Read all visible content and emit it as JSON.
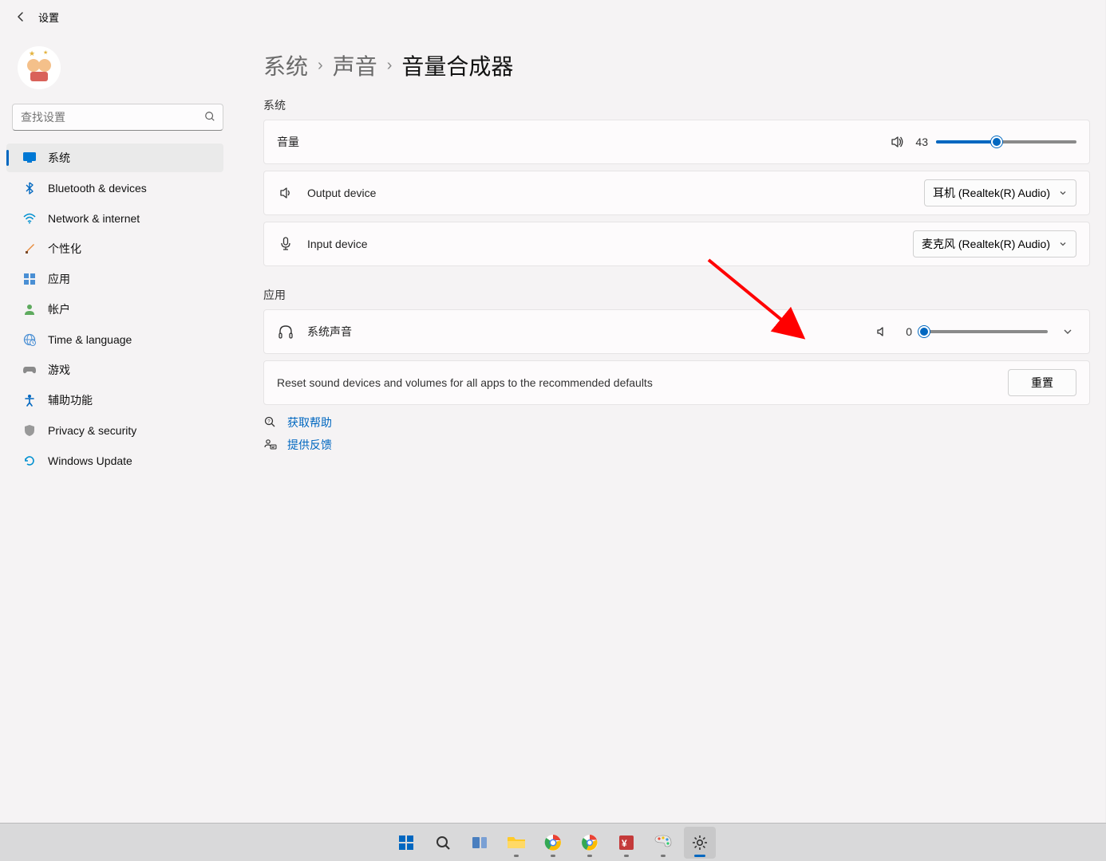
{
  "header": {
    "title": "设置"
  },
  "search": {
    "placeholder": "查找设置"
  },
  "nav": [
    {
      "key": "system",
      "label": "系统",
      "active": true
    },
    {
      "key": "bluetooth",
      "label": "Bluetooth & devices"
    },
    {
      "key": "network",
      "label": "Network & internet"
    },
    {
      "key": "personalization",
      "label": "个性化"
    },
    {
      "key": "apps",
      "label": "应用"
    },
    {
      "key": "accounts",
      "label": "帐户"
    },
    {
      "key": "time",
      "label": "Time & language"
    },
    {
      "key": "gaming",
      "label": "游戏"
    },
    {
      "key": "accessibility",
      "label": "辅助功能"
    },
    {
      "key": "privacy",
      "label": "Privacy & security"
    },
    {
      "key": "update",
      "label": "Windows Update"
    }
  ],
  "breadcrumb": {
    "system": "系统",
    "sound": "声音",
    "mixer": "音量合成器"
  },
  "sections": {
    "system": "系统",
    "apps": "应用"
  },
  "volume": {
    "label": "音量",
    "value": 43
  },
  "output": {
    "label": "Output device",
    "value": "耳机 (Realtek(R) Audio)"
  },
  "input": {
    "label": "Input device",
    "value": "麦克风 (Realtek(R) Audio)"
  },
  "systemSounds": {
    "label": "系统声音",
    "value": 0
  },
  "reset": {
    "text": "Reset sound devices and volumes for all apps to the recommended defaults",
    "button": "重置"
  },
  "links": {
    "help": "获取帮助",
    "feedback": "提供反馈"
  }
}
